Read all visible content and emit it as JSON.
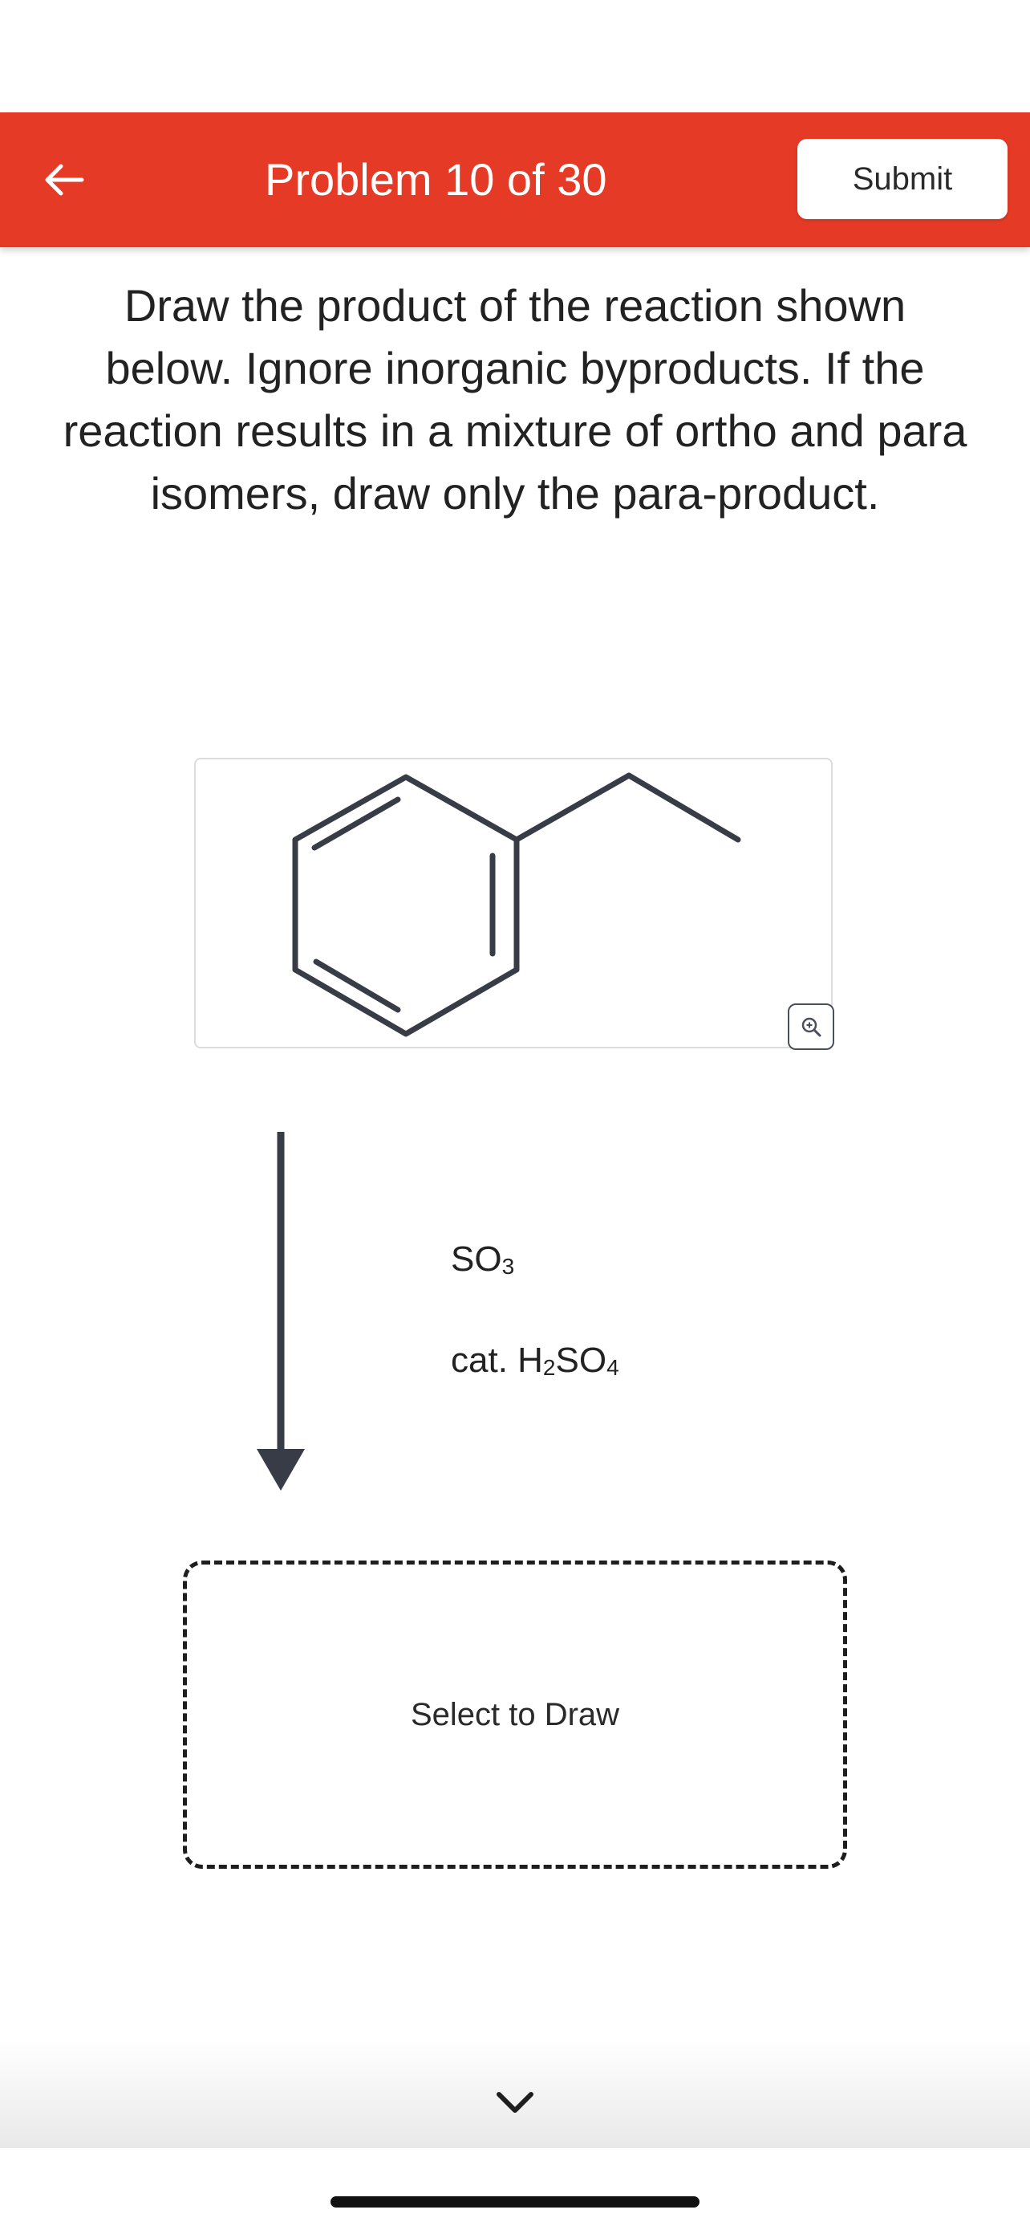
{
  "header": {
    "title": "Problem 10 of 30",
    "submit_label": "Submit",
    "background_color": "#e53b26",
    "back_icon": "arrow-left-icon"
  },
  "prompt": {
    "text": "Draw the product of the reaction shown below. Ignore inorganic byproducts. If the reaction results in a mixture of ortho and para isomers, draw only the para-product."
  },
  "reactant": {
    "structure": "ethylbenzene skeletal structure",
    "zoom_icon": "zoom-in-icon"
  },
  "reagents": {
    "reagent_1": {
      "base": "SO",
      "sub": "3"
    },
    "reagent_2": {
      "prefix": "cat. H",
      "sub1": "2",
      "mid": "SO",
      "sub2": "4"
    }
  },
  "draw_area": {
    "label": "Select to Draw"
  },
  "footer": {
    "chevron_icon": "chevron-down-icon"
  }
}
